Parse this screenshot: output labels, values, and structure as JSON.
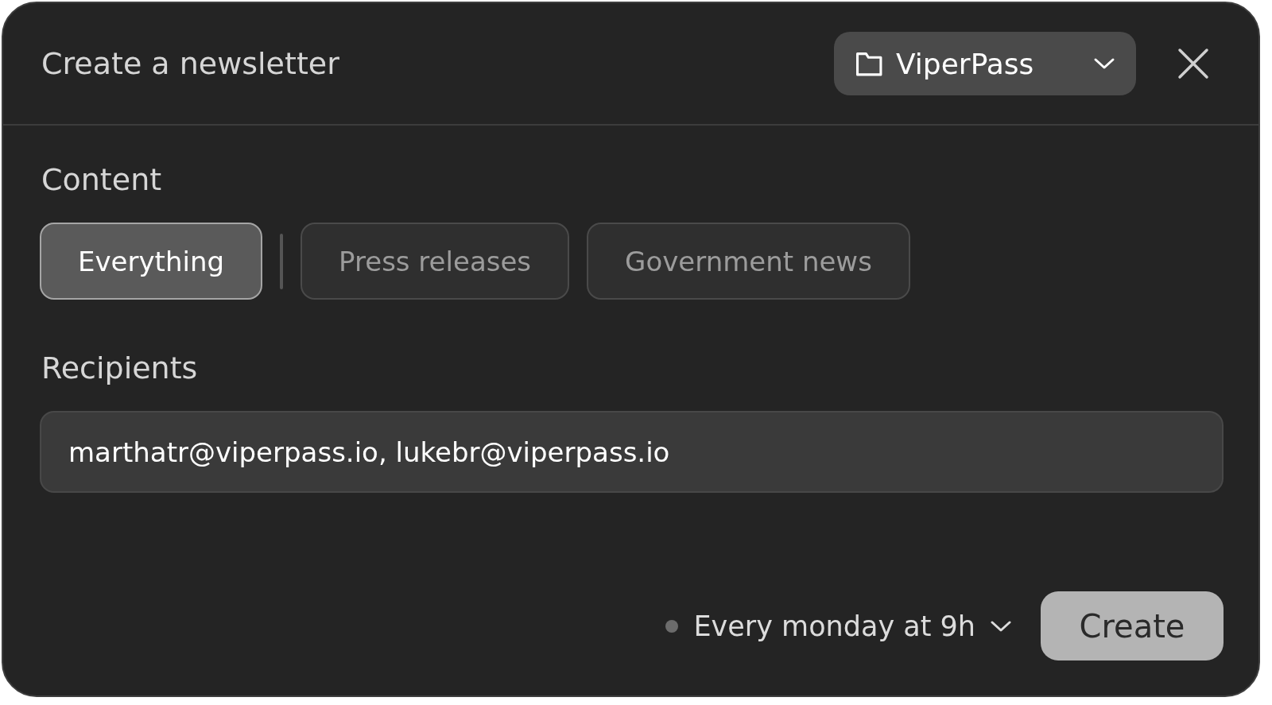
{
  "dialog": {
    "title": "Create a newsletter",
    "workspace": {
      "label": "ViperPass"
    }
  },
  "content": {
    "label": "Content",
    "options": [
      {
        "label": "Everything",
        "selected": true
      },
      {
        "label": "Press releases",
        "selected": false
      },
      {
        "label": "Government news",
        "selected": false
      }
    ]
  },
  "recipients": {
    "label": "Recipients",
    "value": "marthatr@viperpass.io, lukebr@viperpass.io"
  },
  "footer": {
    "schedule": "Every monday at 9h",
    "create_button": "Create"
  }
}
